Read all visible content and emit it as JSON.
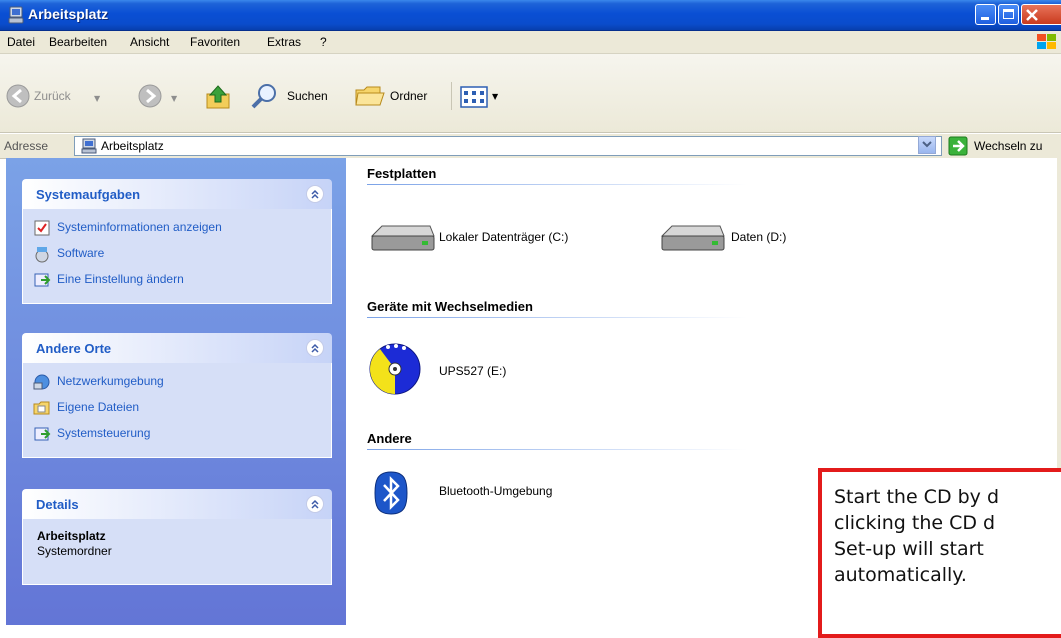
{
  "window": {
    "title": "Arbeitsplatz"
  },
  "menu": [
    "Datei",
    "Bearbeiten",
    "Ansicht",
    "Favoriten",
    "Extras",
    "?"
  ],
  "toolbar": {
    "back_label": "Zurück",
    "search_label": "Suchen",
    "folders_label": "Ordner"
  },
  "address": {
    "label": "Adresse",
    "value": "Arbeitsplatz",
    "go_label": "Wechseln zu"
  },
  "tasks": {
    "system": {
      "title": "Systemaufgaben",
      "items": [
        "Systeminformationen anzeigen",
        "Software",
        "Eine Einstellung ändern"
      ]
    },
    "places": {
      "title": "Andere Orte",
      "items": [
        "Netzwerkumgebung",
        "Eigene Dateien",
        "Systemsteuerung"
      ]
    },
    "details": {
      "title": "Details",
      "name": "Arbeitsplatz",
      "type": "Systemordner"
    }
  },
  "groups": {
    "hard_disks": {
      "title": "Festplatten",
      "items": [
        "Lokaler Datenträger (C:)",
        "Daten (D:)"
      ]
    },
    "removable": {
      "title": "Geräte mit Wechselmedien",
      "items": [
        "UPS527 (E:)"
      ]
    },
    "other": {
      "title": "Andere",
      "items": [
        "Bluetooth-Umgebung"
      ]
    }
  },
  "callout": {
    "text": "Start the CD by d\nclicking the CD d\nSet-up will start\nautomatically."
  },
  "colors": {
    "titlebar": "#0a4fd4",
    "link": "#215dc6",
    "callout_border": "#e31b1b"
  }
}
